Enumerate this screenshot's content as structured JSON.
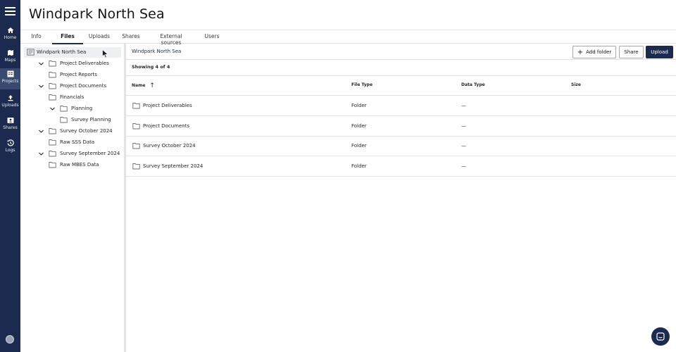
{
  "nav": {
    "items": [
      {
        "label": "Home",
        "icon": "home-icon"
      },
      {
        "label": "Maps",
        "icon": "map-icon"
      },
      {
        "label": "Projects",
        "icon": "projects-icon",
        "active": true
      },
      {
        "label": "Uploads",
        "icon": "upload-icon"
      },
      {
        "label": "Shares",
        "icon": "shares-icon"
      },
      {
        "label": "Logs",
        "icon": "history-icon"
      }
    ]
  },
  "header": {
    "title": "Windpark North Sea"
  },
  "tabs": [
    {
      "label": "Info"
    },
    {
      "label": "Files",
      "active": true
    },
    {
      "label": "Uploads"
    },
    {
      "label": "Shares"
    },
    {
      "label": "External sources"
    },
    {
      "label": "Users"
    }
  ],
  "tree": {
    "root": "Windpark North Sea",
    "items": [
      {
        "label": "Project Deliverables",
        "expanded": true
      },
      {
        "label": "Project Reports"
      },
      {
        "label": "Project Documents",
        "expanded": true
      },
      {
        "label": "Financials"
      },
      {
        "label": "Planning",
        "expanded": true
      },
      {
        "label": "Survey Planning"
      },
      {
        "label": "Survey October 2024",
        "expanded": true
      },
      {
        "label": "Raw SSS Data"
      },
      {
        "label": "Survey September 2024",
        "expanded": true
      },
      {
        "label": "Raw MBES Data"
      }
    ]
  },
  "toolbar": {
    "breadcrumb": "Windpark North Sea",
    "add_folder": "Add folder",
    "share": "Share",
    "upload": "Upload"
  },
  "table": {
    "count": "Showing 4 of 4",
    "columns": {
      "name": "Name",
      "file_type": "File Type",
      "data_type": "Data Type",
      "size": "Size"
    },
    "sort": "ascending",
    "rows": [
      {
        "name": "Project Deliverables",
        "file_type": "Folder",
        "data_type": "—"
      },
      {
        "name": "Project Documents",
        "file_type": "Folder",
        "data_type": "—"
      },
      {
        "name": "Survey October 2024",
        "file_type": "Folder",
        "data_type": "—"
      },
      {
        "name": "Survey September 2024",
        "file_type": "Folder",
        "data_type": "—"
      }
    ]
  },
  "colors": {
    "brand": "#1b2a4e",
    "divider": "#e0e0e0",
    "selected_bg": "#edeff2"
  }
}
